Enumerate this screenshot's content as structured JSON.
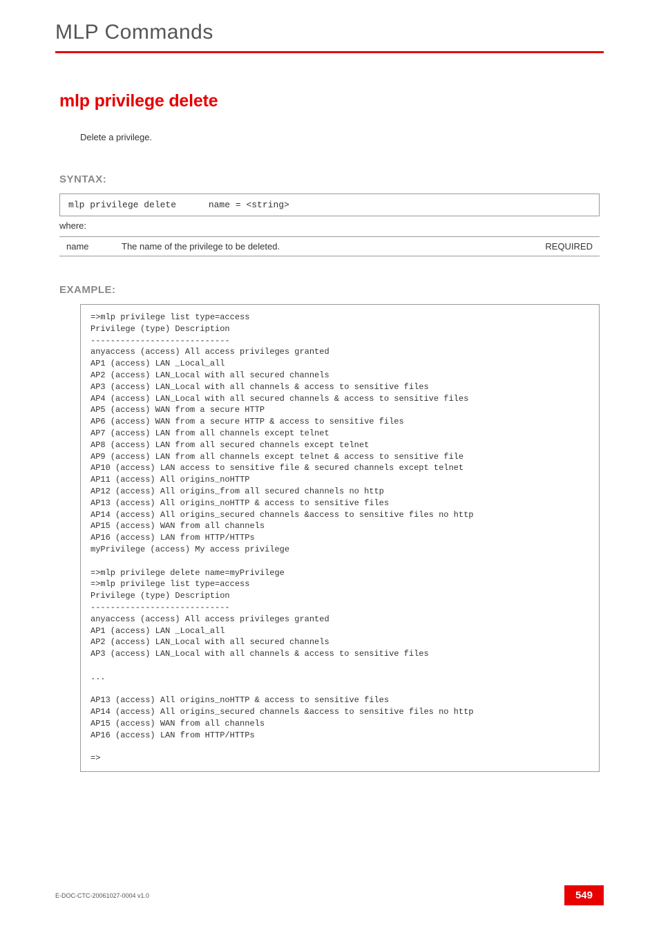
{
  "chapter_title": "MLP Commands",
  "command_title": "mlp privilege delete",
  "intro": "Delete a privilege.",
  "syntax": {
    "heading": "SYNTAX:",
    "code": "mlp privilege delete      name = <string>",
    "where_label": "where:",
    "param_name": "name",
    "param_desc": "The name of the privilege to be deleted.",
    "param_req": "REQUIRED"
  },
  "example": {
    "heading": "EXAMPLE:",
    "body": "=>mlp privilege list type=access\nPrivilege (type) Description\n----------------------------\nanyaccess (access) All access privileges granted\nAP1 (access) LAN _Local_all\nAP2 (access) LAN_Local with all secured channels\nAP3 (access) LAN_Local with all channels & access to sensitive files\nAP4 (access) LAN_Local with all secured channels & access to sensitive files\nAP5 (access) WAN from a secure HTTP\nAP6 (access) WAN from a secure HTTP & access to sensitive files\nAP7 (access) LAN from all channels except telnet\nAP8 (access) LAN from all secured channels except telnet\nAP9 (access) LAN from all channels except telnet & access to sensitive file\nAP10 (access) LAN access to sensitive file & secured channels except telnet\nAP11 (access) All origins_noHTTP\nAP12 (access) All origins_from all secured channels no http\nAP13 (access) All origins_noHTTP & access to sensitive files\nAP14 (access) All origins_secured channels &access to sensitive files no http\nAP15 (access) WAN from all channels\nAP16 (access) LAN from HTTP/HTTPs\nmyPrivilege (access) My access privilege\n\n=>mlp privilege delete name=myPrivilege\n=>mlp privilege list type=access\nPrivilege (type) Description\n----------------------------\nanyaccess (access) All access privileges granted\nAP1 (access) LAN _Local_all\nAP2 (access) LAN_Local with all secured channels\nAP3 (access) LAN_Local with all channels & access to sensitive files\n\n...\n\nAP13 (access) All origins_noHTTP & access to sensitive files\nAP14 (access) All origins_secured channels &access to sensitive files no http\nAP15 (access) WAN from all channels\nAP16 (access) LAN from HTTP/HTTPs\n\n=>"
  },
  "footer": {
    "doc_id": "E-DOC-CTC-20061027-0004 v1.0",
    "page_number": "549"
  }
}
